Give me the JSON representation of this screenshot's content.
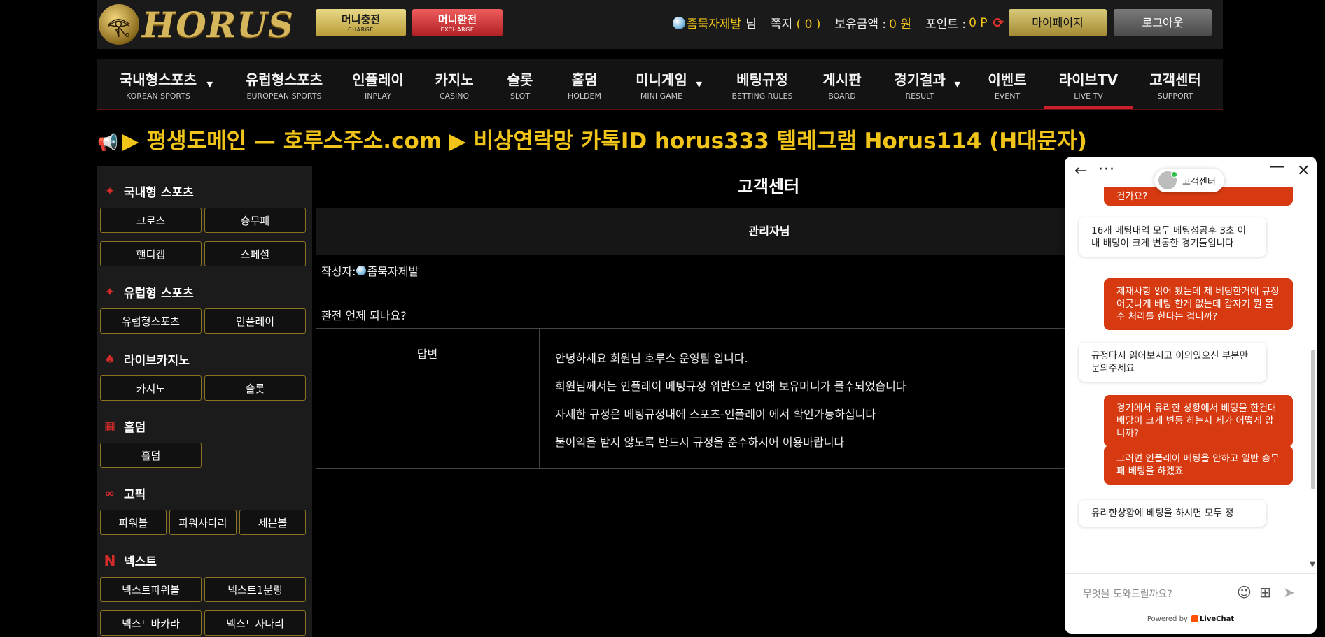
{
  "header": {
    "logo_text": "HORUS",
    "charge": {
      "label": "머니충전",
      "sub": "CHARGE"
    },
    "exchange": {
      "label": "머니환전",
      "sub": "EXCHARGE"
    },
    "user": {
      "name": "좀묵자제발",
      "suffix": "님",
      "note_label": "쪽지",
      "note_count": "( 0 )",
      "balance_label": "보유금액 :",
      "balance_value": "0 원",
      "point_label": "포인트 :",
      "point_value": "0 P"
    },
    "mypage": "마이페이지",
    "logout": "로그아웃"
  },
  "nav": [
    {
      "k": "국내형스포츠",
      "e": "KOREAN SPORTS",
      "dropdown": true
    },
    {
      "k": "유럽형스포츠",
      "e": "EUROPEAN SPORTS"
    },
    {
      "k": "인플레이",
      "e": "INPLAY"
    },
    {
      "k": "카지노",
      "e": "CASINO"
    },
    {
      "k": "슬롯",
      "e": "SLOT"
    },
    {
      "k": "홀덤",
      "e": "HOLDEM"
    },
    {
      "k": "미니게임",
      "e": "MINI GAME",
      "dropdown": true
    },
    {
      "k": "베팅규정",
      "e": "BETTING RULES"
    },
    {
      "k": "게시판",
      "e": "BOARD"
    },
    {
      "k": "경기결과",
      "e": "RESULT",
      "dropdown": true
    },
    {
      "k": "이벤트",
      "e": "EVENT"
    },
    {
      "k": "라이브TV",
      "e": "LIVE TV",
      "active": true
    },
    {
      "k": "고객센터",
      "e": "SUPPORT"
    }
  ],
  "notice": "▶ 평생도메인 — 호루스주소.com ▶ 비상연락망 카톡ID horus333 텔레그램 Horus114 (H대문자)",
  "sidebar": {
    "sections": [
      {
        "title": "국내형 스포츠",
        "buttons": [
          "크로스",
          "승무패",
          "핸디캡",
          "스페셜"
        ]
      },
      {
        "title": "유럽형 스포츠",
        "buttons": [
          "유럽형스포츠",
          "인플레이"
        ]
      },
      {
        "title": "라이브카지노",
        "buttons": [
          "카지노",
          "슬롯"
        ]
      },
      {
        "title": "홀덤",
        "buttons": [
          "홀덤"
        ]
      },
      {
        "title": "고픽",
        "buttons": [
          "파워볼",
          "파워사다리",
          "세븐볼"
        ]
      },
      {
        "title": "넥스트",
        "buttons": [
          "넥스트파워볼",
          "넥스트1분링",
          "넥스트바카라",
          "넥스트사다리"
        ]
      }
    ]
  },
  "main": {
    "title": "고객센터",
    "bar": "관리자님",
    "author_label": "작성자:",
    "author_name": "좀묵자제발",
    "question": "환전 언제 되나요?",
    "answer_label": "답변",
    "answer_lines": [
      "안녕하세요 회원님 호루스 운영팀 입니다.",
      "회원님께서는 인플레이 베팅규정 위반으로 인해 보유머니가 몰수되었습니다",
      "자세한 규정은 베팅규정내에 스포츠-인플레이 에서 확인가능하십니다",
      "불이익을 받지 않도록 반드시 규정을 준수하시어 이용바랍니다"
    ]
  },
  "chat": {
    "agent": "고객센터",
    "messages": [
      {
        "dir": "out",
        "text": "건가요?"
      },
      {
        "dir": "in",
        "text": "16개 베팅내역 모두 베팅성공후 3초 이내 배당이 크게 변동한 경기들입니다"
      },
      {
        "dir": "out",
        "text": "제재사항 읽어 봤는데 제 베팅한거에 규정 어긋나게 베팅 한게 없는데 갑자기 뭔 몰수 처리를 한다는 겁니까?"
      },
      {
        "dir": "in",
        "text": "규정다시 읽어보시고 이의있으신 부분만 문의주세요"
      },
      {
        "dir": "out",
        "text": "경기에서 유리한 상황에서 베팅을 한건대 배당이 크게 변동 하는지 제가 어떻게 압니까?"
      },
      {
        "dir": "out",
        "text": "그러면 인플레이 베팅을 안하고 일반 승무패 베팅을 하겠죠"
      },
      {
        "dir": "in",
        "text": "유리한상황에 베팅을 하시면 모두 정"
      }
    ],
    "placeholder": "무엇을 도와드릴까요?",
    "powered_by": "Powered by",
    "brand": "LiveChat"
  }
}
